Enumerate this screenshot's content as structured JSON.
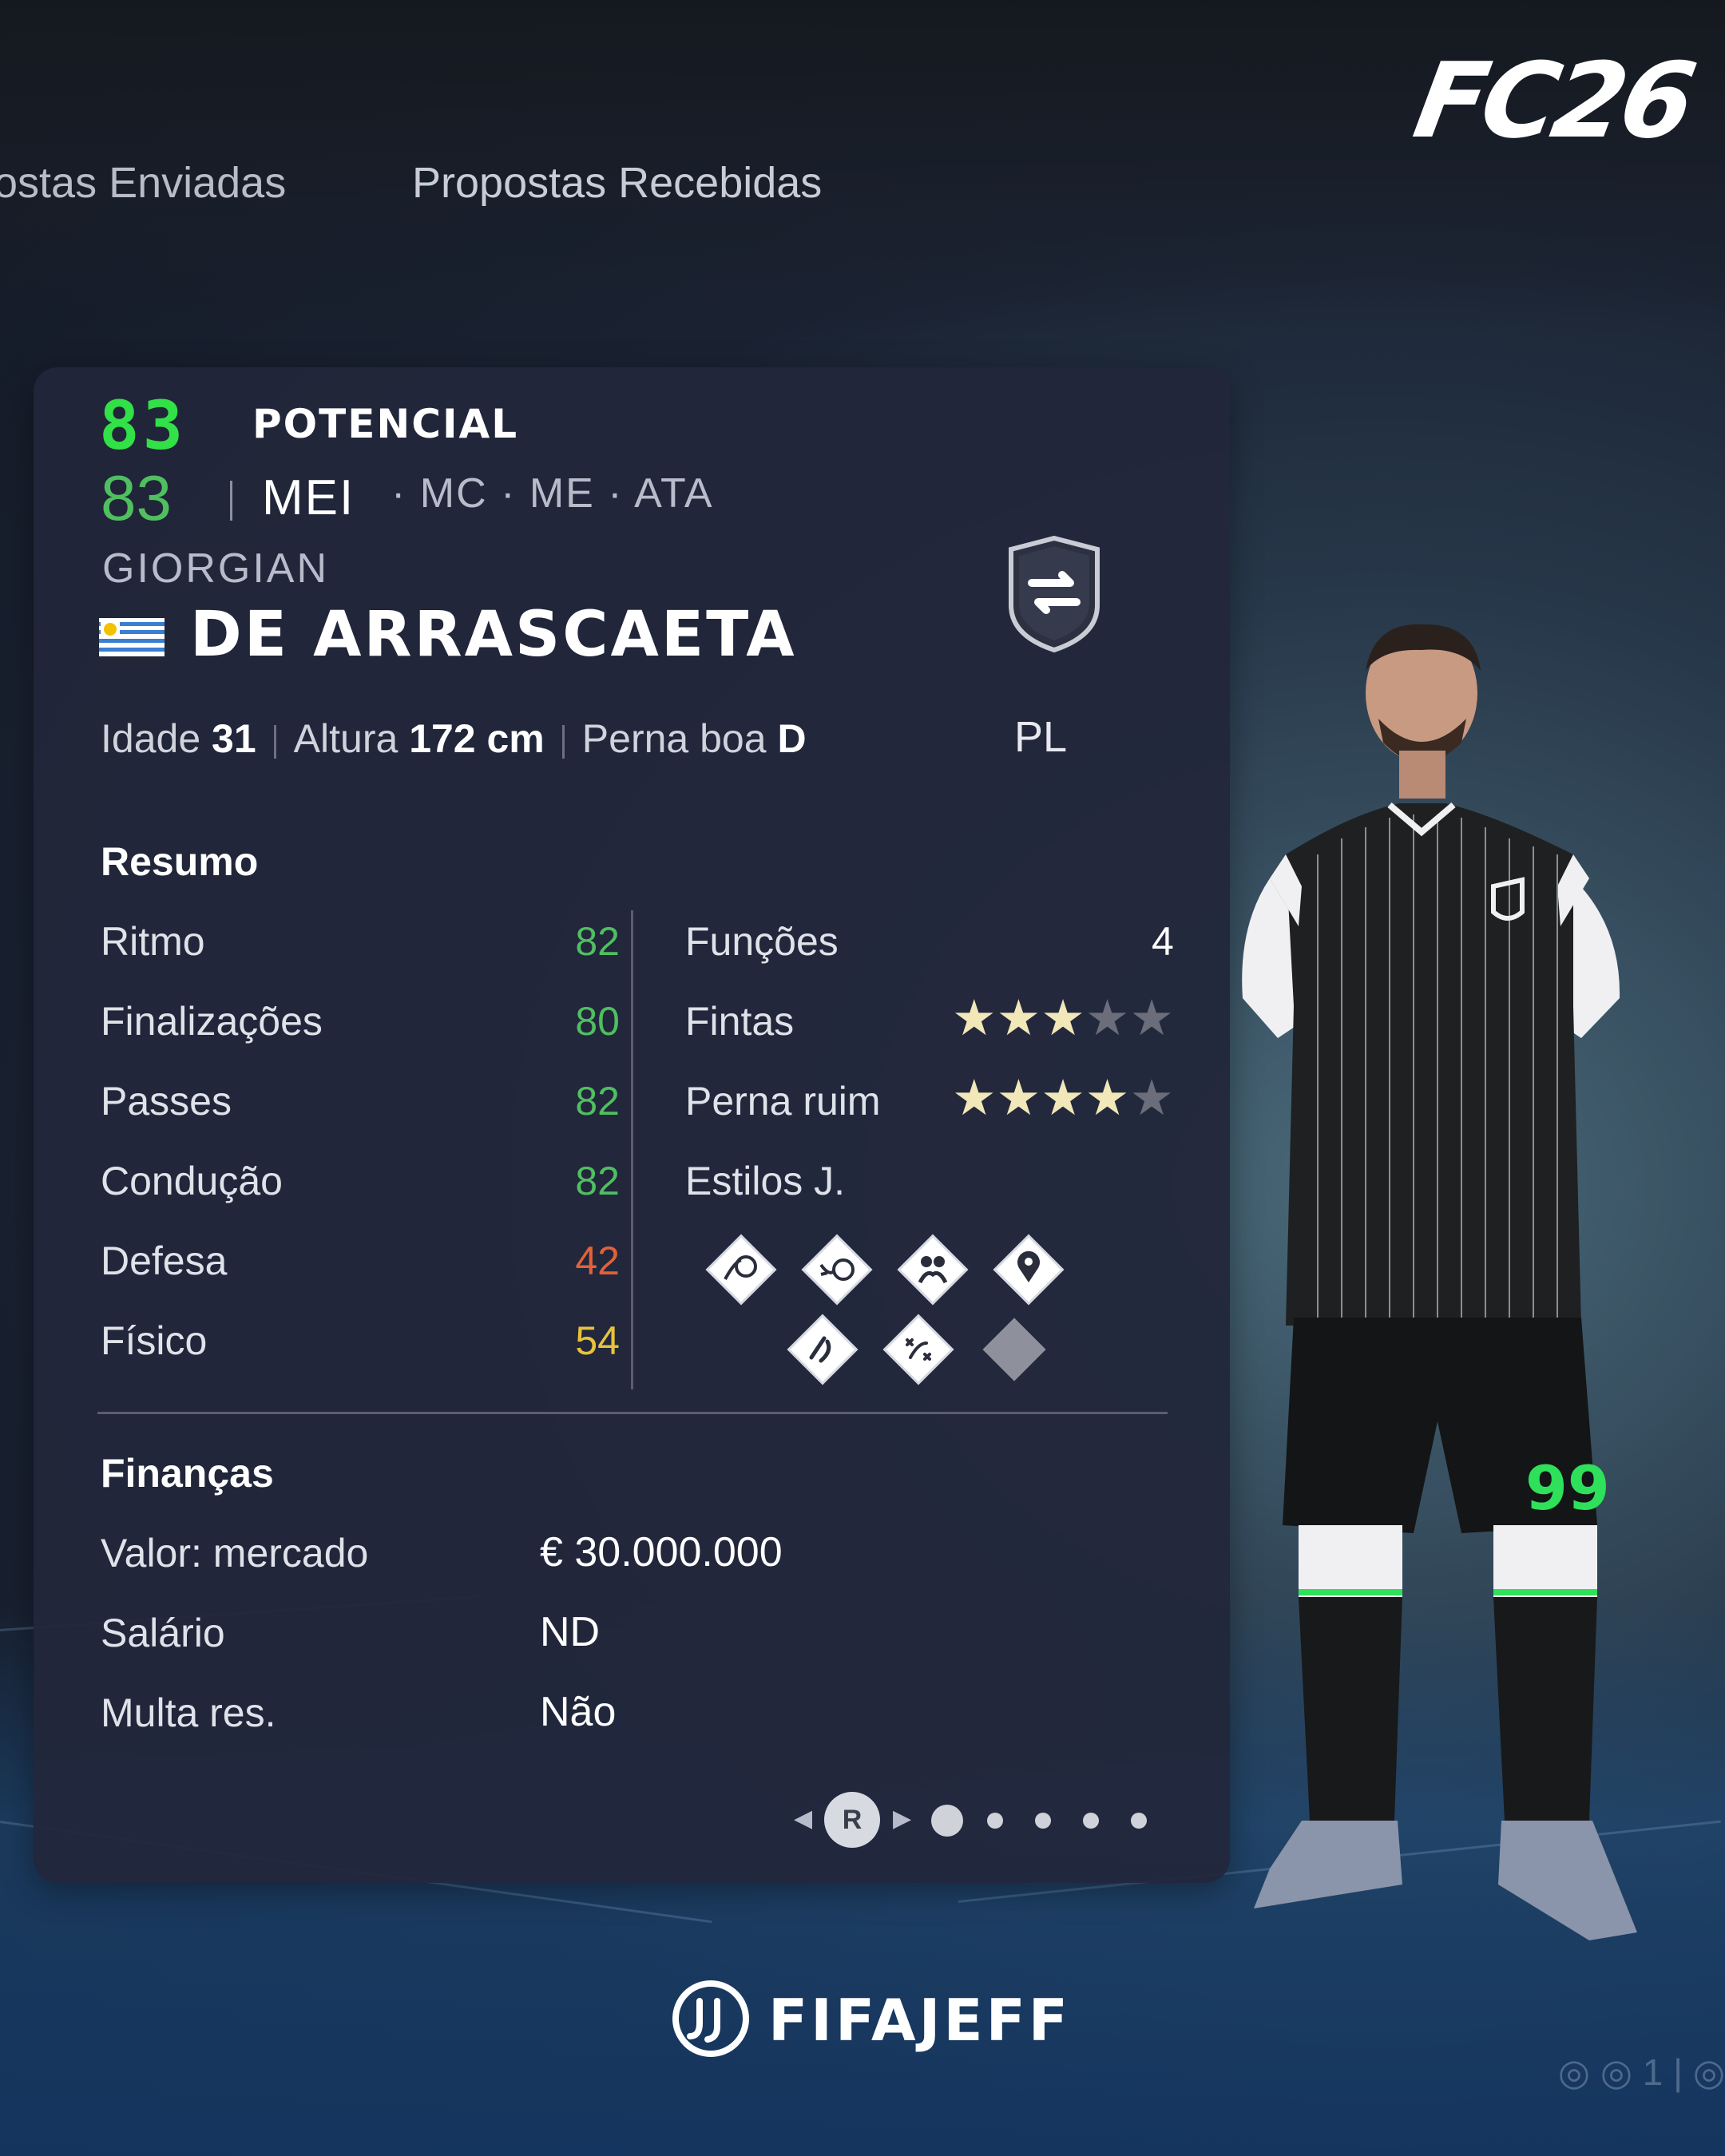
{
  "tabs": {
    "sent": "ostas Enviadas",
    "received": "Propostas Recebidas"
  },
  "logo": "FC26",
  "player": {
    "potential_value": "83",
    "potential_label": "POTENCIAL",
    "overall": "83",
    "main_position": "MEI",
    "alt_positions": "· MC · ME · ATA",
    "first_name": "GIORGIAN",
    "last_name": "DE ARRASCAETA",
    "nationality_flag": "uruguay-flag-icon",
    "role_badge_icon": "swap-arrows-shield-icon",
    "role_label": "PL",
    "age_label": "Idade",
    "age_value": "31",
    "height_label": "Altura",
    "height_value": "172 cm",
    "foot_label": "Perna boa",
    "foot_value": "D"
  },
  "summary": {
    "title": "Resumo",
    "stats": [
      {
        "label": "Ritmo",
        "value": "82",
        "color": "#4fbf60"
      },
      {
        "label": "Finalizações",
        "value": "80",
        "color": "#4fbf60"
      },
      {
        "label": "Passes",
        "value": "82",
        "color": "#4fbf60"
      },
      {
        "label": "Condução",
        "value": "82",
        "color": "#4fbf60"
      },
      {
        "label": "Defesa",
        "value": "42",
        "color": "#e0623a"
      },
      {
        "label": "Físico",
        "value": "54",
        "color": "#e8c23a"
      }
    ],
    "roles_label": "Funções",
    "roles_value": "4",
    "skill_moves_label": "Fintas",
    "skill_moves_stars": 3,
    "weak_foot_label": "Perna ruim",
    "weak_foot_stars": 4,
    "max_stars": 5,
    "playstyles_label": "Estilos J.",
    "playstyles": [
      "finesse-shot-icon",
      "technical-dribble-icon",
      "incisive-pass-icon",
      "location-pin-icon",
      "trickster-icon",
      "tiki-taka-icon",
      "empty-slot-icon"
    ]
  },
  "finance": {
    "title": "Finanças",
    "rows": [
      {
        "label": "Valor: mercado",
        "value": "€ 30.000.000"
      },
      {
        "label": "Salário",
        "value": "ND"
      },
      {
        "label": "Multa res.",
        "value": "Não"
      }
    ]
  },
  "pager": {
    "button_label": "R",
    "pages": 5,
    "current": 1
  },
  "kit": {
    "shirt_number": "99",
    "accent_color": "#2ee05a"
  },
  "watermark": "FIFAJEFF"
}
